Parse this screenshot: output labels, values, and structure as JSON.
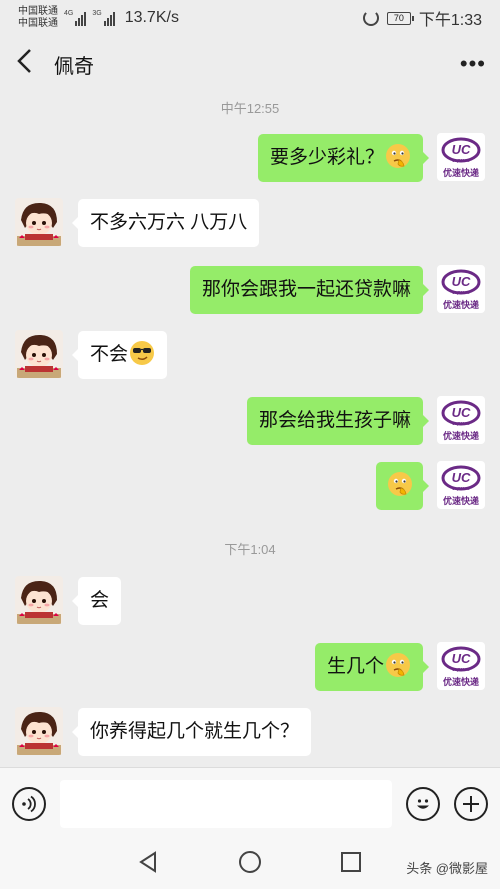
{
  "status_bar": {
    "carrier_1": "中国联通",
    "carrier_2": "中国联通",
    "net_1": "4G",
    "net_2": "3G",
    "speed": "13.7K/s",
    "battery": "70",
    "time": "下午1:33"
  },
  "header": {
    "title": "佩奇",
    "back_icon": "chevron-left-icon",
    "more_icon": "more-dots-icon",
    "more_label": "•••"
  },
  "chat": {
    "timestamps": [
      "中午12:55",
      "下午1:04"
    ],
    "messages": [
      {
        "side": "out",
        "text": "要多少彩礼？",
        "emoji": "thinking-face"
      },
      {
        "side": "in",
        "text": "不多六万六 八万八",
        "emoji": ""
      },
      {
        "side": "out",
        "text": "那你会跟我一起还贷款嘛",
        "emoji": ""
      },
      {
        "side": "in",
        "text": "不会",
        "emoji": "sunglasses-face"
      },
      {
        "side": "out",
        "text": "那会给我生孩子嘛",
        "emoji": ""
      },
      {
        "side": "out",
        "text": "",
        "emoji": "thinking-face"
      },
      {
        "side": "in",
        "text": "会",
        "emoji": ""
      },
      {
        "side": "out",
        "text": "生几个",
        "emoji": "thinking-face"
      },
      {
        "side": "in",
        "text": "你养得起几个就生几个？",
        "emoji": ""
      }
    ],
    "self_avatar": {
      "logo_text": "UC",
      "sub_text": "express",
      "caption": "优速快递",
      "color": "#6b2a86"
    }
  },
  "input_bar": {
    "voice_icon": "voice-icon",
    "emoji_icon": "emoji-icon",
    "plus_icon": "plus-icon",
    "input_value": ""
  },
  "nav_bar": {
    "back_icon": "triangle-back-icon",
    "home_icon": "circle-home-icon",
    "recents_icon": "square-recents-icon"
  },
  "watermark": "头条 @微影屋"
}
